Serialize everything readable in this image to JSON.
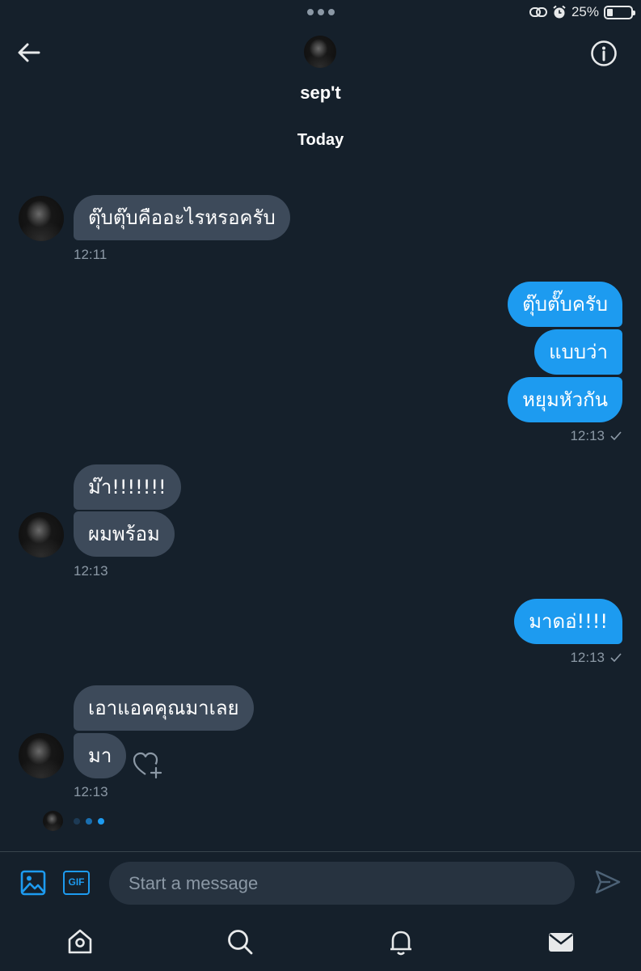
{
  "status_bar": {
    "battery_text": "25%",
    "battery_level": 0.25
  },
  "header": {
    "contact_name": "sep't",
    "day_separator": "Today"
  },
  "messages": [
    {
      "text": "ตุ๊บตุ๊บคืออะไรหรอครับ"
    },
    {
      "text": "ตุ๊บตั๊บครับ"
    },
    {
      "text": "แบบว่า"
    },
    {
      "text": "หยุมหัวกัน"
    },
    {
      "text": "ม๊า!!!!!!!"
    },
    {
      "text": "ผมพร้อม"
    },
    {
      "text": "มาดอ่!!!!"
    },
    {
      "text": "เอาแอคคุณมาเลย"
    },
    {
      "text": "มา"
    }
  ],
  "timestamps": [
    "12:11",
    "12:13",
    "12:13",
    "12:13",
    "12:13"
  ],
  "composer": {
    "placeholder": "Start a message"
  },
  "icons": {
    "back": "arrow-left-icon",
    "info": "info-icon",
    "media": "image-icon",
    "gif": "GIF",
    "send": "send-icon",
    "home": "home-icon",
    "search": "search-icon",
    "notifications": "bell-icon",
    "messages": "mail-icon"
  },
  "colors": {
    "background": "#15202b",
    "incoming_bubble": "#3d4a5a",
    "outgoing_bubble": "#1d9bf0",
    "accent": "#1d9bf0",
    "muted_text": "#8b98a5"
  }
}
